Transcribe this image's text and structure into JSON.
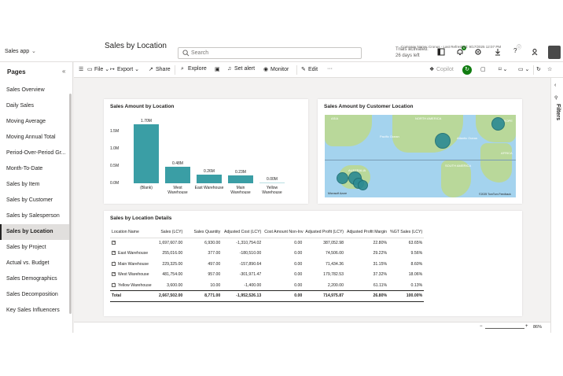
{
  "colors": {
    "accent": "#3a9ea5",
    "map_water": "#a4d3ee",
    "map_land": "#b9d89a"
  },
  "app": {
    "name": "Sales app"
  },
  "search": {
    "placeholder": "Search"
  },
  "trial": {
    "line1": "Trials activated:",
    "line2": "26 days left"
  },
  "notifications": {
    "count": "6"
  },
  "pages_pane": {
    "title": "Pages",
    "items": [
      {
        "label": "Sales Overview"
      },
      {
        "label": "Daily Sales"
      },
      {
        "label": "Moving Average"
      },
      {
        "label": "Moving Annual Total"
      },
      {
        "label": "Period-Over-Period Gr..."
      },
      {
        "label": "Month-To-Date"
      },
      {
        "label": "Sales by Item"
      },
      {
        "label": "Sales by Customer"
      },
      {
        "label": "Sales by Salesperson"
      },
      {
        "label": "Sales by Location"
      },
      {
        "label": "Sales by Project"
      },
      {
        "label": "Actual vs. Budget"
      },
      {
        "label": "Sales Demographics"
      },
      {
        "label": "Sales Decomposition"
      },
      {
        "label": "Key Sales Influencers"
      }
    ],
    "active_index": 9
  },
  "toolbar": {
    "file": "File",
    "export": "Export",
    "share": "Share",
    "explore": "Explore",
    "set_alert": "Set alert",
    "monitor": "Monitor",
    "edit": "Edit",
    "more": "···",
    "copilot": "Copilot"
  },
  "report": {
    "title": "Sales by Location",
    "refresh_info": "Company Name: Cronus - Last Refreshed: 9/17/2025 12:07 PM"
  },
  "filters_pane": {
    "label": "Filters"
  },
  "chart_data": {
    "type": "bar",
    "title": "Sales Amount by Location",
    "categories": [
      "(Blank)",
      "West Warehouse",
      "East Warehouse",
      "Main Warehouse",
      "Yellow Warehouse"
    ],
    "category_lines": [
      [
        "(Blank)"
      ],
      [
        "West",
        "Warehouse"
      ],
      [
        "East Warehouse"
      ],
      [
        "Main",
        "Warehouse"
      ],
      [
        "Yellow",
        "Warehouse"
      ]
    ],
    "values": [
      1.7,
      0.48,
      0.26,
      0.23,
      0.0
    ],
    "data_labels": [
      "1.70M",
      "0.48M",
      "0.26M",
      "0.23M",
      "0.00M"
    ],
    "y_ticks": [
      "1.5M",
      "1.0M",
      "0.5M",
      "0.0M"
    ],
    "y_tick_values": [
      1.5,
      1.0,
      0.5,
      0.0
    ],
    "ylim": [
      0,
      1.75
    ]
  },
  "map": {
    "title": "Sales Amount by Customer Location",
    "labels": [
      "ASIA",
      "NORTH AMERICA",
      "Pacific Ocean",
      "Atlantic Ocean",
      "EUROPE",
      "AFRICA",
      "AUSTRALIA",
      "SOUTH AMERICA"
    ],
    "attribution": "Microsoft Azure",
    "copyright": "©2025 TomTom  Feedback"
  },
  "table": {
    "title": "Sales by Location Details",
    "columns": [
      "Location Name",
      "Sales (LCY)",
      "Sales Quantity",
      "Adjusted Cost (LCY)",
      "Cost Amount Non-Inv",
      "Adjusted Profit (LCY)",
      "Adjusted Profit Margin",
      "%GT Sales (LCY)"
    ],
    "rows": [
      [
        "",
        "1,697,607.00",
        "6,930.00",
        "-1,310,754.02",
        "0.00",
        "387,052.98",
        "22.80%",
        "63.65%"
      ],
      [
        "East Warehouse",
        "255,016.00",
        "377.00",
        "-180,510.00",
        "0.00",
        "74,506.00",
        "29.22%",
        "9.56%"
      ],
      [
        "Main Warehouse",
        "229,325.00",
        "497.00",
        "-157,890.64",
        "0.00",
        "71,434.36",
        "31.15%",
        "8.60%"
      ],
      [
        "West Warehouse",
        "481,754.00",
        "957.00",
        "-301,971.47",
        "0.00",
        "179,782.53",
        "37.32%",
        "18.06%"
      ],
      [
        "Yellow Warehouse",
        "3,600.00",
        "10.00",
        "-1,400.00",
        "0.00",
        "2,200.00",
        "61.11%",
        "0.13%"
      ]
    ],
    "total": [
      "Total",
      "2,667,502.00",
      "8,771.00",
      "-1,952,526.13",
      "0.00",
      "714,975.87",
      "26.80%",
      "100.00%"
    ]
  },
  "zoom": {
    "level": "86%"
  }
}
